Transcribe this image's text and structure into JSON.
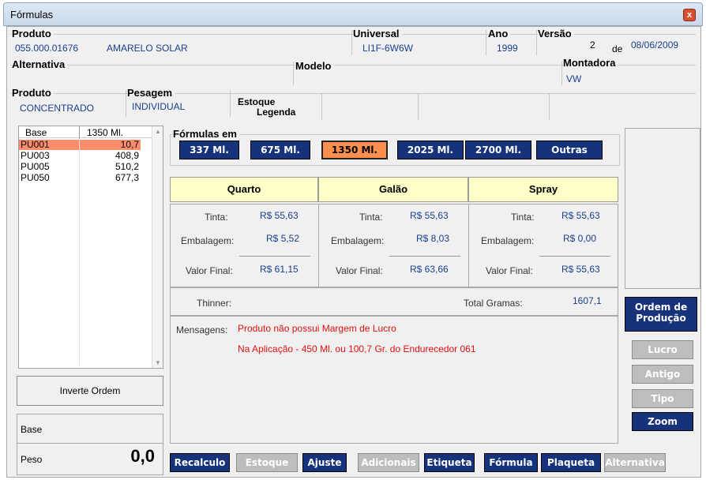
{
  "window": {
    "title": "Fórmulas",
    "close_label": "x"
  },
  "header": {
    "produto_label": "Produto",
    "produto_code": "055.000.01676",
    "produto_name": "AMARELO SOLAR",
    "universal_label": "Universal",
    "universal_value": "LI1F-6W6W",
    "ano_label": "Ano",
    "ano_value": "1999",
    "versao_label": "Versão",
    "versao_num": "2",
    "versao_de": "de",
    "versao_date": "08/06/2009",
    "alternativa_label": "Alternativa",
    "modelo_label": "Modelo",
    "montadora_label": "Montadora",
    "montadora_value": "VW",
    "produto2_label": "Produto",
    "produto2_value": "CONCENTRADO",
    "pesagem_label": "Pesagem",
    "pesagem_value": "INDIVIDUAL",
    "estoque_label": "Estoque",
    "legenda_label": "Legenda"
  },
  "list": {
    "col_base": "Base",
    "col_qty": "1350 Ml.",
    "rows": [
      {
        "base": "PU001",
        "qty": "10,7"
      },
      {
        "base": "PU003",
        "qty": "408,9"
      },
      {
        "base": "PU005",
        "qty": "510,2"
      },
      {
        "base": "PU050",
        "qty": "677,3"
      }
    ]
  },
  "inverte_label": "Inverte Ordem",
  "base_label": "Base",
  "peso_label": "Peso",
  "peso_value": "0,0",
  "formulas": {
    "label": "Fórmulas em",
    "buttons": [
      "337 Ml.",
      "675 Ml.",
      "1350 Ml.",
      "2025 Ml.",
      "2700 Ml.",
      "Outras"
    ]
  },
  "pricing": {
    "headers": [
      "Quarto",
      "Galão",
      "Spray"
    ],
    "tinta_label": "Tinta:",
    "embalagem_label": "Embalagem:",
    "valor_label": "Valor Final:",
    "cols": [
      {
        "tinta": "R$ 55,63",
        "embalagem": "R$ 5,52",
        "valor": "R$ 61,15"
      },
      {
        "tinta": "R$ 55,63",
        "embalagem": "R$ 8,03",
        "valor": "R$ 63,66"
      },
      {
        "tinta": "R$ 55,63",
        "embalagem": "R$ 0,00",
        "valor": "R$ 55,63"
      }
    ]
  },
  "thinner_label": "Thinner:",
  "total_label": "Total Gramas:",
  "total_value": "1607,1",
  "messages": {
    "label": "Mensagens:",
    "line1": "Produto não possui Margem de Lucro",
    "line2": "Na Aplicação - 450 Ml. ou 100,7 Gr. do Endurecedor 061"
  },
  "side": {
    "ordem_line1": "Ordem de",
    "ordem_line2": "Produção",
    "lucro": "Lucro",
    "antigo": "Antigo",
    "tipo": "Tipo",
    "zoom": "Zoom"
  },
  "bottom": {
    "recalculo": "Recalculo",
    "estoque": "Estoque",
    "ajuste": "Ajuste",
    "adicionais": "Adicionais",
    "etiqueta": "Etiqueta",
    "formula": "Fórmula",
    "plaqueta": "Plaqueta",
    "alternativa": "Alternativa"
  }
}
